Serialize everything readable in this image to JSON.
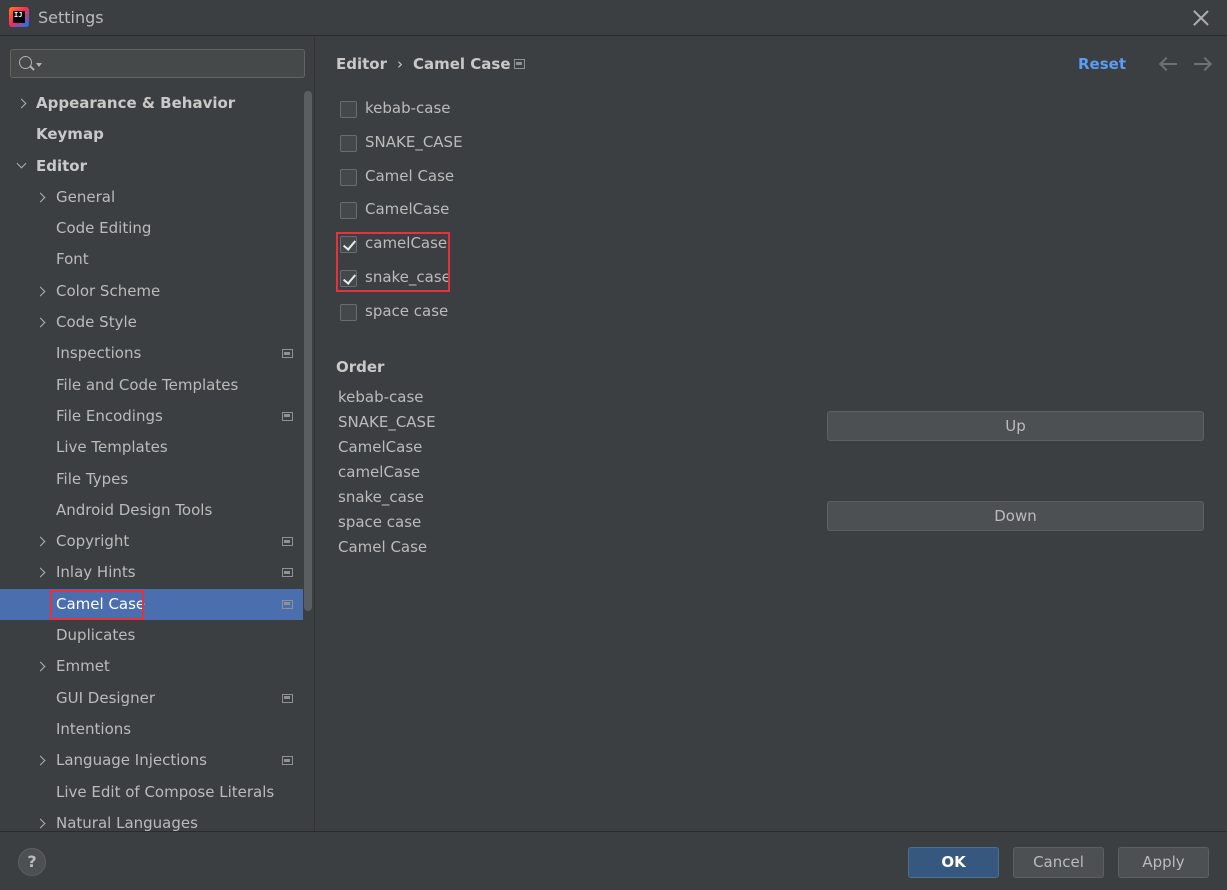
{
  "window": {
    "title": "Settings"
  },
  "search": {
    "placeholder": "",
    "value": ""
  },
  "sidebar": {
    "items": [
      {
        "label": "Appearance & Behavior",
        "level": 0,
        "expander": "collapsed",
        "bold": true,
        "project_icon": false,
        "selected": false
      },
      {
        "label": "Keymap",
        "level": 0,
        "expander": "none",
        "bold": true,
        "project_icon": false,
        "selected": false
      },
      {
        "label": "Editor",
        "level": 0,
        "expander": "expanded",
        "bold": true,
        "project_icon": false,
        "selected": false
      },
      {
        "label": "General",
        "level": 1,
        "expander": "collapsed",
        "bold": false,
        "project_icon": false,
        "selected": false
      },
      {
        "label": "Code Editing",
        "level": 1,
        "expander": "none",
        "bold": false,
        "project_icon": false,
        "selected": false
      },
      {
        "label": "Font",
        "level": 1,
        "expander": "none",
        "bold": false,
        "project_icon": false,
        "selected": false
      },
      {
        "label": "Color Scheme",
        "level": 1,
        "expander": "collapsed",
        "bold": false,
        "project_icon": false,
        "selected": false
      },
      {
        "label": "Code Style",
        "level": 1,
        "expander": "collapsed",
        "bold": false,
        "project_icon": false,
        "selected": false
      },
      {
        "label": "Inspections",
        "level": 1,
        "expander": "none",
        "bold": false,
        "project_icon": true,
        "selected": false
      },
      {
        "label": "File and Code Templates",
        "level": 1,
        "expander": "none",
        "bold": false,
        "project_icon": false,
        "selected": false
      },
      {
        "label": "File Encodings",
        "level": 1,
        "expander": "none",
        "bold": false,
        "project_icon": true,
        "selected": false
      },
      {
        "label": "Live Templates",
        "level": 1,
        "expander": "none",
        "bold": false,
        "project_icon": false,
        "selected": false
      },
      {
        "label": "File Types",
        "level": 1,
        "expander": "none",
        "bold": false,
        "project_icon": false,
        "selected": false
      },
      {
        "label": "Android Design Tools",
        "level": 1,
        "expander": "none",
        "bold": false,
        "project_icon": false,
        "selected": false
      },
      {
        "label": "Copyright",
        "level": 1,
        "expander": "collapsed",
        "bold": false,
        "project_icon": true,
        "selected": false
      },
      {
        "label": "Inlay Hints",
        "level": 1,
        "expander": "collapsed",
        "bold": false,
        "project_icon": true,
        "selected": false
      },
      {
        "label": "Camel Case",
        "level": 1,
        "expander": "none",
        "bold": false,
        "project_icon": true,
        "selected": true
      },
      {
        "label": "Duplicates",
        "level": 1,
        "expander": "none",
        "bold": false,
        "project_icon": false,
        "selected": false
      },
      {
        "label": "Emmet",
        "level": 1,
        "expander": "collapsed",
        "bold": false,
        "project_icon": false,
        "selected": false
      },
      {
        "label": "GUI Designer",
        "level": 1,
        "expander": "none",
        "bold": false,
        "project_icon": true,
        "selected": false
      },
      {
        "label": "Intentions",
        "level": 1,
        "expander": "none",
        "bold": false,
        "project_icon": false,
        "selected": false
      },
      {
        "label": "Language Injections",
        "level": 1,
        "expander": "collapsed",
        "bold": false,
        "project_icon": true,
        "selected": false
      },
      {
        "label": "Live Edit of Compose Literals",
        "level": 1,
        "expander": "none",
        "bold": false,
        "project_icon": false,
        "selected": false
      },
      {
        "label": "Natural Languages",
        "level": 1,
        "expander": "collapsed",
        "bold": false,
        "project_icon": false,
        "selected": false
      }
    ]
  },
  "main": {
    "breadcrumb": {
      "parent": "Editor",
      "separator": "›",
      "current": "Camel Case"
    },
    "reset_label": "Reset",
    "checkboxes": [
      {
        "label": "kebab-case",
        "checked": false
      },
      {
        "label": "SNAKE_CASE",
        "checked": false
      },
      {
        "label": "Camel Case",
        "checked": false
      },
      {
        "label": "CamelCase",
        "checked": false
      },
      {
        "label": "camelCase",
        "checked": true
      },
      {
        "label": "snake_case",
        "checked": true
      },
      {
        "label": "space case",
        "checked": false
      }
    ],
    "order": {
      "title": "Order",
      "items": [
        "kebab-case",
        "SNAKE_CASE",
        "CamelCase",
        "camelCase",
        "snake_case",
        "space case",
        "Camel Case"
      ]
    },
    "up_label": "Up",
    "down_label": "Down"
  },
  "footer": {
    "help_label": "?",
    "ok_label": "OK",
    "cancel_label": "Cancel",
    "apply_label": "Apply"
  },
  "colors": {
    "background": "#3c3f41",
    "selection": "#4b6eaf",
    "link": "#589df6",
    "highlight_border": "#e5323e",
    "ok_button": "#365880"
  }
}
